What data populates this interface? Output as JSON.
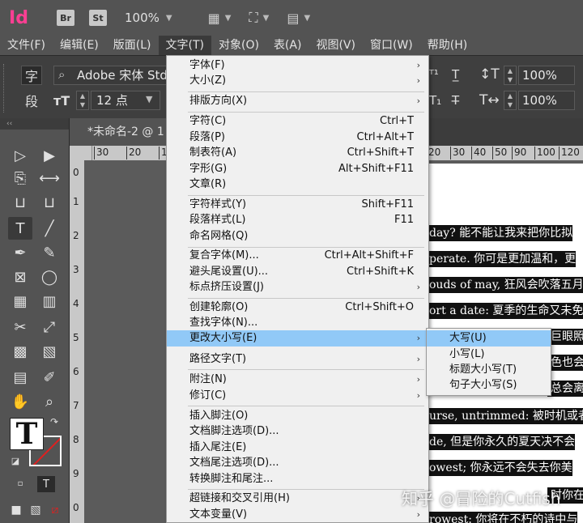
{
  "titlebar": {
    "app_logo": "Id",
    "bridge_badge": "Br",
    "stock_badge": "St",
    "zoom": "100%",
    "icons": [
      "chevron-down-icon",
      "frame-edge-icon",
      "screen-mode-icon",
      "arrange-docs-icon"
    ]
  },
  "menubar": {
    "items": [
      "文件(F)",
      "编辑(E)",
      "版面(L)",
      "文字(T)",
      "对象(O)",
      "表(A)",
      "视图(V)",
      "窗口(W)",
      "帮助(H)"
    ],
    "active_index": 3
  },
  "control_panel": {
    "char_mode_label": "字",
    "para_mode_label": "段",
    "font_name": "Adobe 宋体 Std",
    "font_size": "12 点",
    "scale_vertical": "100%",
    "scale_horizontal": "100%"
  },
  "document": {
    "tab_title": "*未命名-2 @ 1",
    "ruler_h": [
      "30",
      "20",
      "10",
      "0",
      "10",
      "20",
      "30",
      "40",
      "50",
      "60",
      "70",
      "80",
      "90",
      "100",
      "110",
      "120"
    ],
    "ruler_v": [
      "0",
      "1",
      "2",
      "3",
      "4",
      "5",
      "6",
      "7",
      "8",
      "9",
      "0"
    ],
    "page_lines": [
      "day? 能不能让我来把你比拟",
      "perate. 你可是更加温和，更",
      "ouds of may, 狂风会吹落五月",
      "ort a date: 夏季的生命又未免",
      "巨眼照",
      "色也会",
      "总会离",
      "urse, untrimmed: 被时机或者",
      "de, 但是你永久的夏天决不会",
      "owest; 你永远不会失去你美",
      "时你在",
      "rowest: 你将在不朽的诗中与"
    ]
  },
  "type_menu": {
    "items": [
      {
        "label": "字体(F)",
        "shortcut": "",
        "submenu": true
      },
      {
        "label": "大小(Z)",
        "shortcut": "",
        "submenu": true
      },
      {
        "label": "排版方向(X)",
        "shortcut": "",
        "submenu": true
      },
      {
        "label": "字符(C)",
        "shortcut": "Ctrl+T",
        "submenu": false
      },
      {
        "label": "段落(P)",
        "shortcut": "Ctrl+Alt+T",
        "submenu": false
      },
      {
        "label": "制表符(A)",
        "shortcut": "Ctrl+Shift+T",
        "submenu": false
      },
      {
        "label": "字形(G)",
        "shortcut": "Alt+Shift+F11",
        "submenu": false
      },
      {
        "label": "文章(R)",
        "shortcut": "",
        "submenu": false
      },
      {
        "label": "字符样式(Y)",
        "shortcut": "Shift+F11",
        "submenu": false
      },
      {
        "label": "段落样式(L)",
        "shortcut": "F11",
        "submenu": false
      },
      {
        "label": "命名网格(Q)",
        "shortcut": "",
        "submenu": false
      },
      {
        "label": "复合字体(M)...",
        "shortcut": "Ctrl+Alt+Shift+F",
        "submenu": false
      },
      {
        "label": "避头尾设置(U)...",
        "shortcut": "Ctrl+Shift+K",
        "submenu": false
      },
      {
        "label": "标点挤压设置(J)",
        "shortcut": "",
        "submenu": true
      },
      {
        "label": "创建轮廓(O)",
        "shortcut": "Ctrl+Shift+O",
        "submenu": false
      },
      {
        "label": "查找字体(N)...",
        "shortcut": "",
        "submenu": false
      },
      {
        "label": "更改大小写(E)",
        "shortcut": "",
        "submenu": true
      },
      {
        "label": "路径文字(T)",
        "shortcut": "",
        "submenu": true
      },
      {
        "label": "附注(N)",
        "shortcut": "",
        "submenu": true
      },
      {
        "label": "修订(C)",
        "shortcut": "",
        "submenu": true
      },
      {
        "label": "插入脚注(O)",
        "shortcut": "",
        "submenu": false
      },
      {
        "label": "文档脚注选项(D)...",
        "shortcut": "",
        "submenu": false
      },
      {
        "label": "插入尾注(E)",
        "shortcut": "",
        "submenu": false
      },
      {
        "label": "文档尾注选项(D)...",
        "shortcut": "",
        "submenu": false
      },
      {
        "label": "转换脚注和尾注...",
        "shortcut": "",
        "submenu": false
      },
      {
        "label": "超链接和交叉引用(H)",
        "shortcut": "",
        "submenu": true
      },
      {
        "label": "文本变量(V)",
        "shortcut": "",
        "submenu": true
      }
    ],
    "highlight_index": 16
  },
  "change_case_submenu": {
    "items": [
      "大写(U)",
      "小写(L)",
      "标题大小写(T)",
      "句子大小写(S)"
    ],
    "highlight_index": 0
  },
  "watermark": "知乎 @冒险的Cutfish",
  "colors": {
    "menubar_bg": "#535353",
    "panel_bg": "#3f3f3f",
    "menu_bg": "#f0f0f0",
    "menu_highlight": "#91c9f7",
    "app_accent": "#fd3f93"
  }
}
